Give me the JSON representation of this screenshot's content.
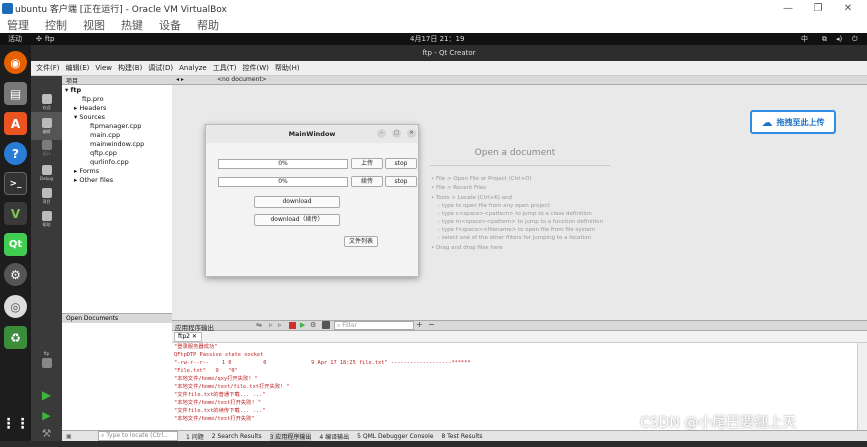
{
  "vbox": {
    "title": "ubuntu 客户端 [正在运行] - Oracle VM VirtualBox",
    "menu": [
      "管理",
      "控制",
      "视图",
      "热键",
      "设备",
      "帮助"
    ]
  },
  "topbar": {
    "activities": "活动",
    "app": "ftp",
    "clock": "4月17日 21：19",
    "ime": "中"
  },
  "qtcreator": {
    "title": "ftp - Qt Creator",
    "menu": [
      "文件(F)",
      "编辑(E)",
      "View",
      "构建(B)",
      "调试(D)",
      "Analyze",
      "工具(T)",
      "控件(W)",
      "帮助(H)"
    ],
    "modes": [
      "欢迎",
      "编辑",
      "设计",
      "Debug",
      "项目",
      "帮助"
    ],
    "kit_label": "ftp",
    "project_header": "项目",
    "project_tree": {
      "root": "ftp",
      "pro": "ftp.pro",
      "headers": "Headers",
      "sources": "Sources",
      "source_files": [
        "ftpmanager.cpp",
        "main.cpp",
        "mainwindow.cpp",
        "qftp.cpp",
        "qurlinfo.cpp"
      ],
      "forms": "Forms",
      "other": "Other files"
    },
    "open_documents_header": "Open Documents",
    "editor_doc_label": "<no document>",
    "open_document_title": "Open a document",
    "hints": [
      "• File > Open File or Project (Ctrl+O)",
      "• File > Recent Files",
      "• Tools > Locate (Ctrl+K) and",
      "- type to open file from any open project",
      "- type c<space><pattern> to jump to a class definition",
      "- type m<space><pattern> to jump to a function definition",
      "- type f<space><filename> to open file from file system",
      "- select one of the other filters for jumping to a location",
      "• Drag and drop files here"
    ],
    "output": {
      "header": "应用程序输出",
      "filter_placeholder": "Filter",
      "tab": "ftp2",
      "lines": [
        "\"登录服务器成功\"",
        "QFtpDTP Passive state socket",
        "\"-rw-r--r--    1 0          0              9 Apr 17 18:25 file.txt\" -------------------******",
        "\"File.txt\"   9   \"0\"",
        "\"本地文件/home/qxy打开失败! \"",
        "\"本地文件/home/test/file.txt打开失败! \"",
        "\"文件file.txt的普通下载... ...\"",
        "\"本地文件/home/test打开失败! \"",
        "\"文件file.txt的续传下载... ...\"",
        "\"本地文件/home/test打开失败\""
      ]
    },
    "statusbar": {
      "locate_placeholder": "Type to locate (Ctrl...",
      "items": [
        "1 问题",
        "2 Search Results",
        "3 应用程序输出",
        "4 编译输出",
        "5 QML Debugger Console",
        "8 Test Results"
      ]
    }
  },
  "dialog": {
    "title": "MainWindow",
    "progress1": "0%",
    "progress2": "0%",
    "upload": "上传",
    "stop1": "stop",
    "resume": "续传",
    "stop2": "stop",
    "download": "download",
    "download_resume": "download（续传）",
    "file_list": "文件列表"
  },
  "overlay": {
    "upload_widget": "拖拽至此上传",
    "watermark": "CSDN @小尾巴要翘上天"
  },
  "colors": {
    "accent_blue": "#2e8ce6",
    "output_red": "#c02020",
    "dock_bg": "#1d1d1d"
  }
}
